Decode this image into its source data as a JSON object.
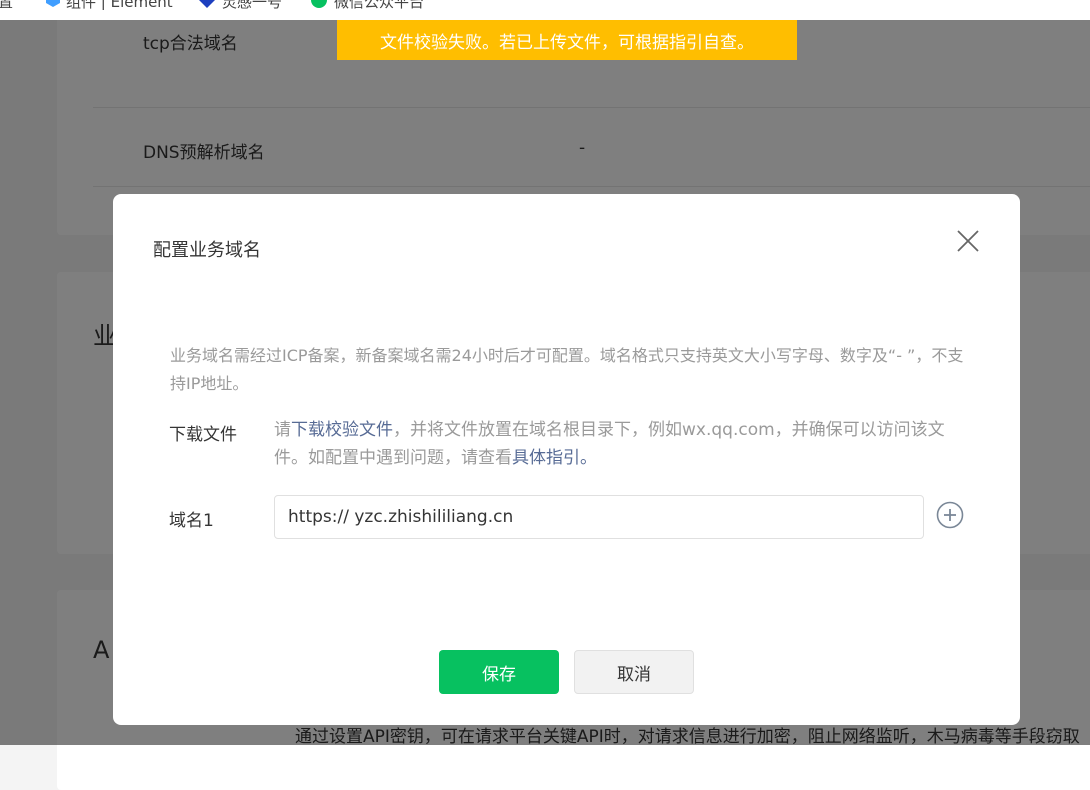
{
  "browser": {
    "bookmarks": [
      {
        "label": "置",
        "icon": "none"
      },
      {
        "label": "组件 | Element",
        "icon": "element-logo-icon"
      },
      {
        "label": "灵感一号",
        "icon": "blue-diamond-icon"
      },
      {
        "label": "微信公众平台",
        "icon": "wechat-icon"
      }
    ]
  },
  "toast": {
    "message": "文件校验失败。若已上传文件，可根据指引自查。",
    "color": "#ffbe00"
  },
  "background_page": {
    "rows": [
      {
        "label": "tcp合法域名",
        "value": ""
      },
      {
        "label": "DNS预解析域名",
        "value": "-"
      }
    ],
    "section2_title": "业",
    "section3_title": "A",
    "api_description": "通过设置API密钥，可在请求平台关键API时，对请求信息进行加密，阻止网络监听，木马病毒等手段窃取"
  },
  "dialog": {
    "title": "配置业务域名",
    "notice": "业务域名需经过ICP备案，新备案域名需24小时后才可配置。域名格式只支持英文大小写字母、数字及“- ”，不支持IP地址。",
    "download": {
      "label": "下载文件",
      "text_1": "请",
      "link_1": "下载校验文件",
      "text_2": "，并将文件放置在域名根目录下，例如wx.qq.com，并确保可以访问该文件。如配置中遇到问题，请查看",
      "link_2": "具体指引",
      "text_3": "。"
    },
    "domain": {
      "label": "域名1",
      "value": "https:// yzc.zhishililiang.cn"
    },
    "save_label": "保存",
    "cancel_label": "取消",
    "accent_color": "#07c160"
  }
}
